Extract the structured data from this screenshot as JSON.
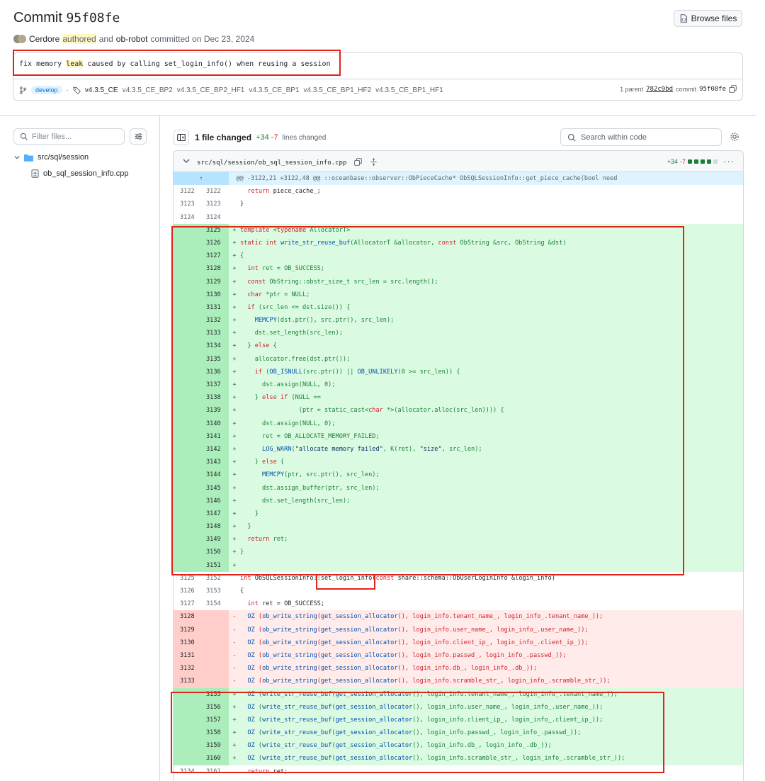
{
  "commit": {
    "title_prefix": "Commit",
    "sha": "95f08fe",
    "browse_label": "Browse files",
    "author": "Cerdore",
    "authored": "authored",
    "and": "and",
    "committer": "ob-robot",
    "committed_on": "committed on Dec 23, 2024",
    "message_pre": "fix memory ",
    "message_hl": "leak",
    "message_post": " caused by calling set_login_info() when reusing a session",
    "branch": "develop",
    "tags": [
      "v4.3.5_CE",
      "v4.3.5_CE_BP2",
      "v4.3.5_CE_BP2_HF1",
      "v4.3.5_CE_BP1",
      "v4.3.5_CE_BP1_HF2",
      "v4.3.5_CE_BP1_HF1"
    ],
    "parent_label": "1 parent",
    "parent_sha": "782c9bd",
    "commit_label": "commit",
    "commit_sha": "95f08fe"
  },
  "sidebar": {
    "filter_placeholder": "Filter files...",
    "folder": "src/sql/session",
    "file": "ob_sql_session_info.cpp"
  },
  "toolbar": {
    "files_changed": "1 file changed",
    "additions": "+34",
    "deletions": "-7",
    "lines_changed": "lines changed",
    "search_placeholder": "Search within code"
  },
  "file": {
    "path": "src/sql/session/ob_sql_session_info.cpp",
    "additions": "+34",
    "deletions": "-7"
  },
  "colors": {
    "add": "#1a7f37",
    "del": "#d1242f",
    "annotation": "#e2231a"
  },
  "diff_rows": [
    {
      "t": "hunk",
      "o": "",
      "n": "",
      "c": "@@ -3122,21 +3122,48 @@ ::oceanbase::observer::ObPieceCache* ObSQLSessionInfo::get_piece_cache(bool need"
    },
    {
      "t": "ctx",
      "o": "3122",
      "n": "3122",
      "c": "  return piece_cache_;"
    },
    {
      "t": "ctx",
      "o": "3123",
      "n": "3123",
      "c": "}"
    },
    {
      "t": "ctx",
      "o": "3124",
      "n": "3124",
      "c": ""
    },
    {
      "t": "add",
      "o": "",
      "n": "3125",
      "c": "template <typename AllocatorT>"
    },
    {
      "t": "add",
      "o": "",
      "n": "3126",
      "c": "static int write_str_reuse_buf(AllocatorT &allocator, const ObString &src, ObString &dst)"
    },
    {
      "t": "add",
      "o": "",
      "n": "3127",
      "c": "{"
    },
    {
      "t": "add",
      "o": "",
      "n": "3128",
      "c": "  int ret = OB_SUCCESS;"
    },
    {
      "t": "add",
      "o": "",
      "n": "3129",
      "c": "  const ObString::obstr_size_t src_len = src.length();"
    },
    {
      "t": "add",
      "o": "",
      "n": "3130",
      "c": "  char *ptr = NULL;"
    },
    {
      "t": "add",
      "o": "",
      "n": "3131",
      "c": "  if (src_len <= dst.size()) {"
    },
    {
      "t": "add",
      "o": "",
      "n": "3132",
      "c": "    MEMCPY(dst.ptr(), src.ptr(), src_len);"
    },
    {
      "t": "add",
      "o": "",
      "n": "3133",
      "c": "    dst.set_length(src_len);"
    },
    {
      "t": "add",
      "o": "",
      "n": "3134",
      "c": "  } else {"
    },
    {
      "t": "add",
      "o": "",
      "n": "3135",
      "c": "    allocator.free(dst.ptr());"
    },
    {
      "t": "add",
      "o": "",
      "n": "3136",
      "c": "    if (OB_ISNULL(src.ptr()) || OB_UNLIKELY(0 >= src_len)) {"
    },
    {
      "t": "add",
      "o": "",
      "n": "3137",
      "c": "      dst.assign(NULL, 0);"
    },
    {
      "t": "add",
      "o": "",
      "n": "3138",
      "c": "    } else if (NULL =="
    },
    {
      "t": "add",
      "o": "",
      "n": "3139",
      "c": "                (ptr = static_cast<char *>(allocator.alloc(src_len)))) {"
    },
    {
      "t": "add",
      "o": "",
      "n": "3140",
      "c": "      dst.assign(NULL, 0);"
    },
    {
      "t": "add",
      "o": "",
      "n": "3141",
      "c": "      ret = OB_ALLOCATE_MEMORY_FAILED;"
    },
    {
      "t": "add",
      "o": "",
      "n": "3142",
      "c": "      LOG_WARN(\"allocate memory failed\", K(ret), \"size\", src_len);"
    },
    {
      "t": "add",
      "o": "",
      "n": "3143",
      "c": "    } else {"
    },
    {
      "t": "add",
      "o": "",
      "n": "3144",
      "c": "      MEMCPY(ptr, src.ptr(), src_len);"
    },
    {
      "t": "add",
      "o": "",
      "n": "3145",
      "c": "      dst.assign_buffer(ptr, src_len);"
    },
    {
      "t": "add",
      "o": "",
      "n": "3146",
      "c": "      dst.set_length(src_len);"
    },
    {
      "t": "add",
      "o": "",
      "n": "3147",
      "c": "    }"
    },
    {
      "t": "add",
      "o": "",
      "n": "3148",
      "c": "  }"
    },
    {
      "t": "add",
      "o": "",
      "n": "3149",
      "c": "  return ret;"
    },
    {
      "t": "add",
      "o": "",
      "n": "3150",
      "c": "}"
    },
    {
      "t": "add",
      "o": "",
      "n": "3151",
      "c": ""
    },
    {
      "t": "ctx",
      "o": "3125",
      "n": "3152",
      "c": "int ObSQLSessionInfo::set_login_info(const share::schema::ObUserLoginInfo &login_info)"
    },
    {
      "t": "ctx",
      "o": "3126",
      "n": "3153",
      "c": "{"
    },
    {
      "t": "ctx",
      "o": "3127",
      "n": "3154",
      "c": "  int ret = OB_SUCCESS;"
    },
    {
      "t": "del",
      "o": "3128",
      "n": "",
      "c": "  OZ (ob_write_string(get_session_allocator(), login_info.tenant_name_, login_info_.tenant_name_));"
    },
    {
      "t": "del",
      "o": "3129",
      "n": "",
      "c": "  OZ (ob_write_string(get_session_allocator(), login_info.user_name_, login_info_.user_name_));"
    },
    {
      "t": "del",
      "o": "3130",
      "n": "",
      "c": "  OZ (ob_write_string(get_session_allocator(), login_info.client_ip_, login_info_.client_ip_));"
    },
    {
      "t": "del",
      "o": "3131",
      "n": "",
      "c": "  OZ (ob_write_string(get_session_allocator(), login_info.passwd_, login_info_.passwd_));"
    },
    {
      "t": "del",
      "o": "3132",
      "n": "",
      "c": "  OZ (ob_write_string(get_session_allocator(), login_info.db_, login_info_.db_));"
    },
    {
      "t": "del",
      "o": "3133",
      "n": "",
      "c": "  OZ (ob_write_string(get_session_allocator(), login_info.scramble_str_, login_info_.scramble_str_));"
    },
    {
      "t": "add",
      "o": "",
      "n": "3155",
      "c": "  OZ (write_str_reuse_buf(get_session_allocator(), login_info.tenant_name_, login_info_.tenant_name_));"
    },
    {
      "t": "add",
      "o": "",
      "n": "3156",
      "c": "  OZ (write_str_reuse_buf(get_session_allocator(), login_info.user_name_, login_info_.user_name_));"
    },
    {
      "t": "add",
      "o": "",
      "n": "3157",
      "c": "  OZ (write_str_reuse_buf(get_session_allocator(), login_info.client_ip_, login_info_.client_ip_));"
    },
    {
      "t": "add",
      "o": "",
      "n": "3158",
      "c": "  OZ (write_str_reuse_buf(get_session_allocator(), login_info.passwd_, login_info_.passwd_));"
    },
    {
      "t": "add",
      "o": "",
      "n": "3159",
      "c": "  OZ (write_str_reuse_buf(get_session_allocator(), login_info.db_, login_info_.db_));"
    },
    {
      "t": "add",
      "o": "",
      "n": "3160",
      "c": "  OZ (write_str_reuse_buf(get_session_allocator(), login_info.scramble_str_, login_info_.scramble_str_));"
    },
    {
      "t": "ctx",
      "o": "3134",
      "n": "3161",
      "c": "  return ret;"
    }
  ]
}
